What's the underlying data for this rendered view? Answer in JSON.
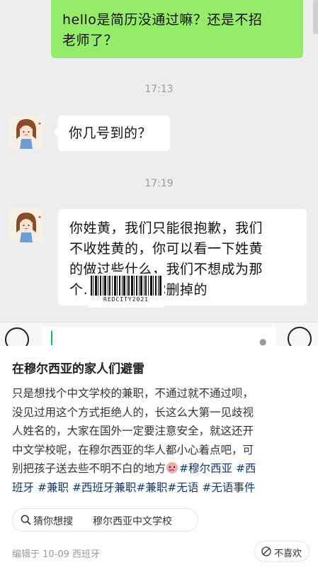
{
  "chat": {
    "outgoing_message": [
      "hello是简历没通过嘛？还是不招",
      "老师了？"
    ],
    "time_1": "17:13",
    "incoming_message_1": "你几号到的？",
    "time_2": "17:19",
    "incoming_message_2": [
      "你姓黄，我们只能很抱歉，我们",
      "不收姓黄的，你可以看一下姓黄",
      "的做过些什么，我们不想成为那",
      "个……我会把你删掉的"
    ],
    "watermark_code": "REDCITY2021"
  },
  "post": {
    "title": "在穆尔西亚的家人们避雷",
    "body_lines": [
      "只是想找个中文学校的兼职，不通过就不通过呗，",
      "没见过用这个方式拒绝人的，长这么大第一见歧视",
      "人姓名的，大家在国外一定要注意安全，就这还开",
      "中文学校呢，在穆尔西亚的华人都小心着点吧，可",
      "别把孩子送去些不明不白的地方"
    ],
    "tags": [
      "#穆尔西亚",
      "#西",
      "班牙",
      "#兼职",
      "#西班牙兼职",
      "#兼职",
      "#无语",
      "#无语事件"
    ],
    "search_prefix": "猜你想搜",
    "search_keyword": "穆尔西亚中文学校",
    "meta": "编辑于 10-09 西班牙",
    "dislike_label": "不喜欢"
  },
  "icons": {
    "voice": "voice-icon",
    "emoji": "emoji-icon",
    "search": "search-icon",
    "dislike": "dislike-icon"
  },
  "colors": {
    "outgoing_bubble": "#95ec69",
    "chat_background": "#ededed",
    "tag_link": "#13386c",
    "cursor": "#07c160"
  }
}
